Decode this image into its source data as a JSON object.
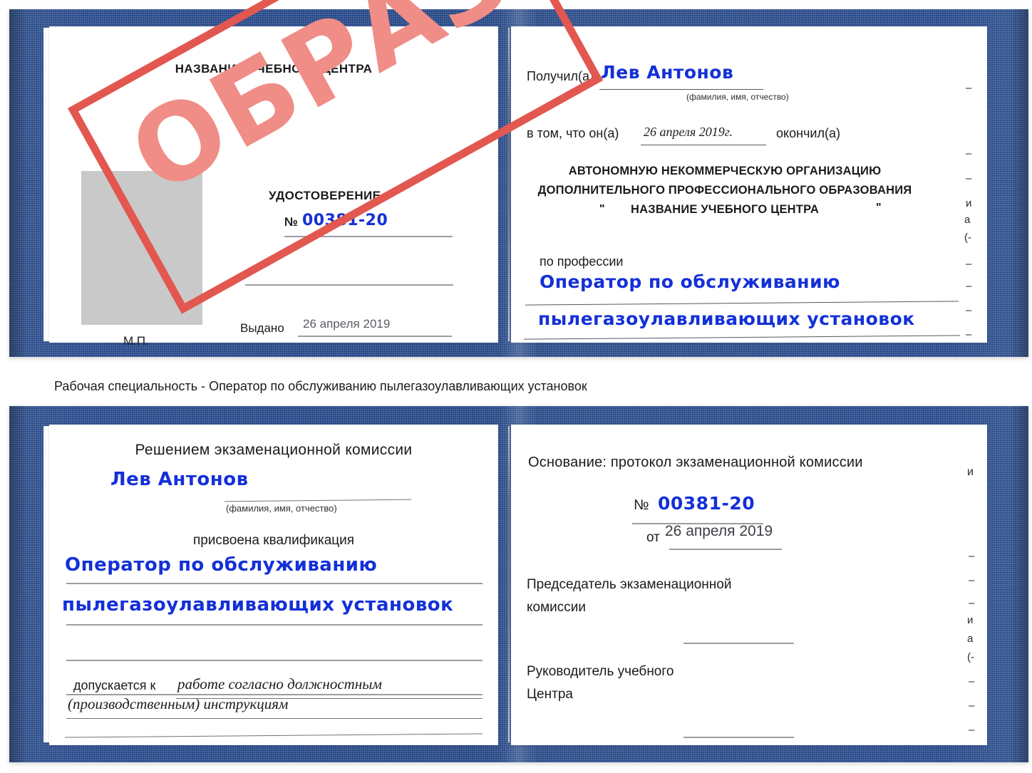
{
  "caption": "Рабочая специальность - Оператор по обслуживанию пылегазоулавливающих установок",
  "colors": {
    "cover_blue": "#26488a",
    "stamp_red": "#e2574f",
    "stamp_fill": "#ef8d86",
    "handwriting_blue": "#1330d8",
    "photo_placeholder": "#c9c9c9",
    "rule_gray": "#9b9da1"
  },
  "stamp": {
    "label": "ОБРАЗЕЦ"
  },
  "certificate_top": {
    "left_page": {
      "center_name": "НАЗВАНИЕ УЧЕБНОГО ЦЕНТРА",
      "doc_type": "УДОСТОВЕРЕНИЕ",
      "number_prefix": "№",
      "number_value": "00381-20",
      "issued_label": "Выдано",
      "issued_value": "26 апреля 2019",
      "seal_label": "М.П."
    },
    "right_page": {
      "received_label": "Получил(а)",
      "received_value": "Лев Антонов",
      "fio_hint": "(фамилия, имя, отчество)",
      "that_he_label": "в том, что он(а)",
      "that_he_value": "26 апреля 2019г.",
      "finished_label": "окончил(а)",
      "org_line1": "АВТОНОМНУЮ НЕКОММЕРЧЕСКУЮ ОРГАНИЗАЦИЮ",
      "org_line2": "ДОПОЛНИТЕЛЬНОГО ПРОФЕССИОНАЛЬНОГО ОБРАЗОВАНИЯ",
      "org_quote_open": "\"",
      "org_line3": "НАЗВАНИЕ УЧЕБНОГО ЦЕНТРА",
      "org_quote_close": "\"",
      "profession_label": "по профессии",
      "profession_value_line1": "Оператор по обслуживанию",
      "profession_value_line2": "пылегазоулавливающих установок",
      "edge_fragments": [
        "–",
        "–",
        "–",
        "и",
        "а",
        "(-",
        "–",
        "–",
        "–",
        "–"
      ]
    }
  },
  "certificate_bottom": {
    "left_page": {
      "heading": "Решением экзаменационной комиссии",
      "name_value": "Лев Антонов",
      "fio_hint": "(фамилия, имя, отчество)",
      "qualification_label": "присвоена квалификация",
      "qualification_line1": "Оператор по обслуживанию",
      "qualification_line2": "пылегазоулавливающих установок",
      "admitted_label": "допускается к",
      "admitted_value_line1": "работе согласно должностным",
      "admitted_value_line2": "(производственным) инструкциям"
    },
    "right_page": {
      "basis_label": "Основание: протокол экзаменационной комиссии",
      "number_prefix": "№",
      "number_value": "00381-20",
      "date_prefix": "от",
      "date_value": "26 апреля 2019",
      "chairman_line1": "Председатель экзаменационной",
      "chairman_line2": "комиссии",
      "head_line1": "Руководитель учебного",
      "head_line2": "Центра",
      "edge_fragments": [
        "и",
        "–",
        "–",
        "–",
        "и",
        "а",
        "(-",
        "–",
        "–",
        "–",
        "–"
      ]
    }
  }
}
